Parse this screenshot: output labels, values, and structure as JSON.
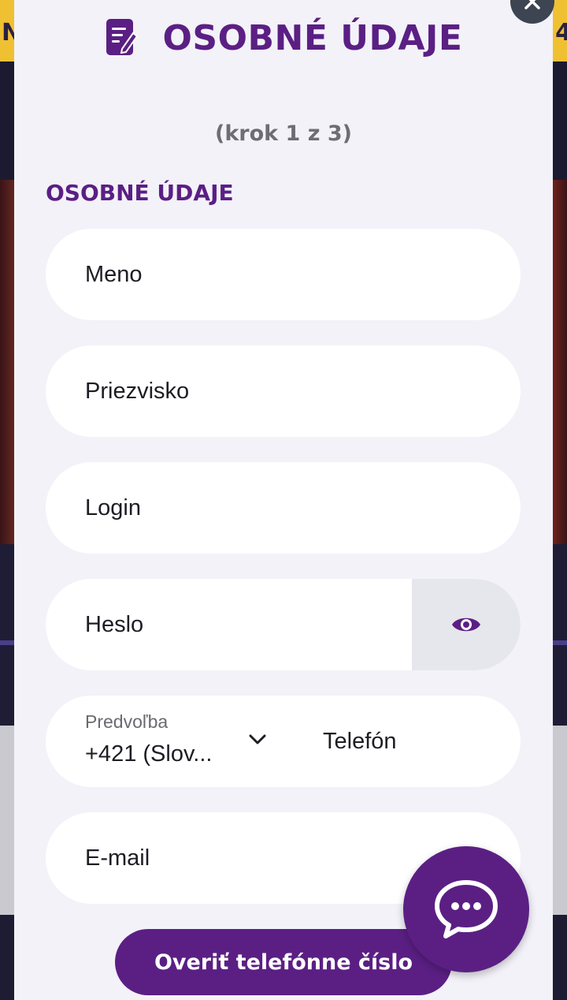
{
  "background": {
    "topbar_left": "N",
    "topbar_right": "4"
  },
  "modal": {
    "title": "OSOBNÉ ÚDAJE",
    "step": "(krok 1 z 3)",
    "section_title": "OSOBNÉ ÚDAJE",
    "fields": {
      "first_name": "Meno",
      "last_name": "Priezvisko",
      "login": "Login",
      "password": "Heslo",
      "prefix_label": "Predvoľba",
      "prefix_value": "+421 (Slov...",
      "phone": "Telefón",
      "email": "E-mail"
    },
    "verify_button": "Overiť telefónne číslo"
  },
  "icons": {
    "close": "close-icon",
    "document": "document-edit-icon",
    "eye": "eye-icon",
    "chevron": "chevron-down-icon",
    "chat": "chat-bubble-icon"
  },
  "colors": {
    "accent": "#5b1f84",
    "modal_bg": "#f3f2f8",
    "field_bg": "#ffffff"
  }
}
